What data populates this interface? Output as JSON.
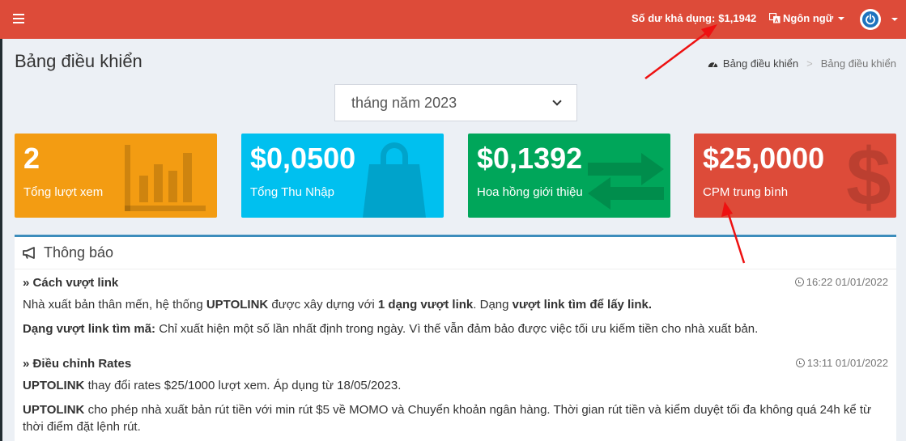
{
  "topbar": {
    "balance_label": "Số dư khả dụng:",
    "balance_value": "$1,1942",
    "language_label": "Ngôn ngữ"
  },
  "page": {
    "title": "Bảng điều khiển",
    "breadcrumb": [
      "Bảng điều khiển",
      "Bảng điều khiển"
    ]
  },
  "period_select": {
    "selected": "tháng năm 2023"
  },
  "stats": [
    {
      "value": "2",
      "label": "Tổng lượt xem",
      "icon": "bar-chart-icon",
      "color": "#f39c12"
    },
    {
      "value": "$0,0500",
      "label": "Tổng Thu Nhập",
      "icon": "shopping-bag-icon",
      "color": "#00c0ef"
    },
    {
      "value": "$0,1392",
      "label": "Hoa hồng giới thiệu",
      "icon": "exchange-icon",
      "color": "#00a65a"
    },
    {
      "value": "$25,0000",
      "label": "CPM trung bình",
      "icon": "dollar-icon",
      "color": "#dd4b39"
    }
  ],
  "announcements": {
    "title": "Thông báo",
    "items": [
      {
        "title": "Cách vượt link",
        "time": "16:22 01/01/2022",
        "p1": {
          "a": "Nhà xuất bản thân mến, hệ thống ",
          "b": "UPTOLINK",
          "c": " được xây dựng với ",
          "d": "1 dạng vượt link",
          "e": ". Dạng ",
          "f": "vượt link tìm để lấy link."
        },
        "p2": {
          "a": "Dạng vượt link tìm mã:",
          "b": " Chỉ xuất hiện một số lần nhất định trong ngày. Vì thế vẫn đảm bảo được việc tối ưu kiếm tiền cho nhà xuất bản."
        }
      },
      {
        "title": "Điều chỉnh Rates",
        "time": "13:11 01/01/2022",
        "p1": {
          "a": "UPTOLINK",
          "b": " thay đổi rates $25/1000 lượt xem. Áp dụng từ 18/05/2023."
        },
        "p2": {
          "a": "UPTOLINK",
          "b": " cho phép nhà xuất bản rút tiền với min rút $5 về MOMO và Chuyển khoản ngân hàng. Thời gian rút tiền và kiểm duyệt tối đa không quá 24h kể từ thời điểm đặt lệnh rút."
        }
      }
    ]
  },
  "colors": {
    "topbar": "#dd4b39",
    "panel_accent": "#3c8dbc",
    "annotation_arrow": "#ee1111"
  }
}
